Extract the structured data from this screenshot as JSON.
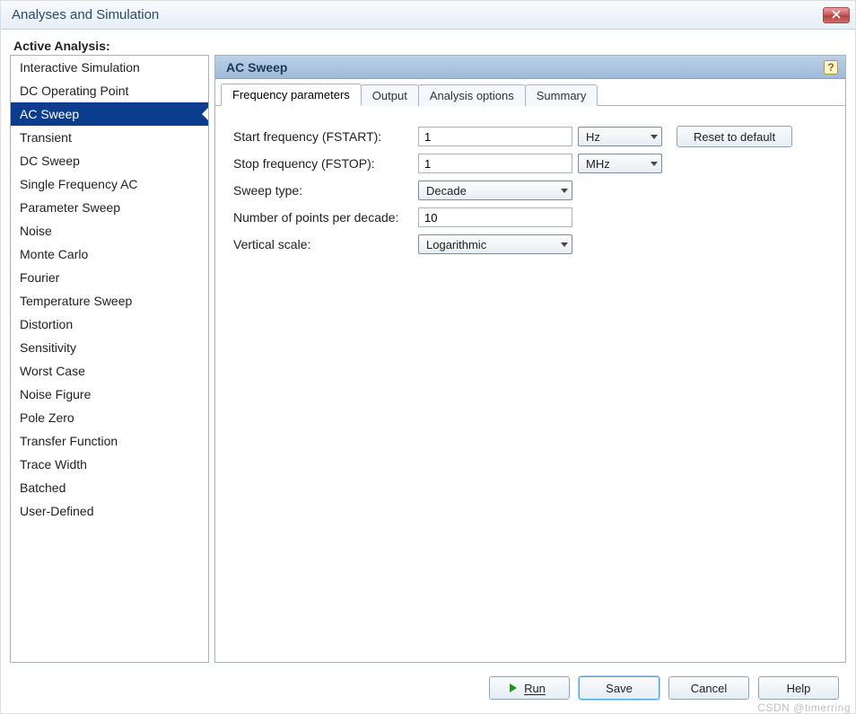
{
  "titlebar": {
    "title": "Analyses and Simulation"
  },
  "section_label": "Active Analysis:",
  "sidebar": {
    "items": [
      {
        "label": "Interactive Simulation"
      },
      {
        "label": "DC Operating Point"
      },
      {
        "label": "AC Sweep"
      },
      {
        "label": "Transient"
      },
      {
        "label": "DC Sweep"
      },
      {
        "label": "Single Frequency AC"
      },
      {
        "label": "Parameter Sweep"
      },
      {
        "label": "Noise"
      },
      {
        "label": "Monte Carlo"
      },
      {
        "label": "Fourier"
      },
      {
        "label": "Temperature Sweep"
      },
      {
        "label": "Distortion"
      },
      {
        "label": "Sensitivity"
      },
      {
        "label": "Worst Case"
      },
      {
        "label": "Noise Figure"
      },
      {
        "label": "Pole Zero"
      },
      {
        "label": "Transfer Function"
      },
      {
        "label": "Trace Width"
      },
      {
        "label": "Batched"
      },
      {
        "label": "User-Defined"
      }
    ],
    "selected_index": 2
  },
  "main": {
    "header": "AC Sweep",
    "help_icon_glyph": "?",
    "tabs": [
      {
        "label": "Frequency parameters"
      },
      {
        "label": "Output"
      },
      {
        "label": "Analysis options"
      },
      {
        "label": "Summary"
      }
    ],
    "active_tab_index": 0,
    "form": {
      "start_freq": {
        "label": "Start frequency (FSTART):",
        "value": "1",
        "unit": "Hz"
      },
      "stop_freq": {
        "label": "Stop frequency (FSTOP):",
        "value": "1",
        "unit": "MHz"
      },
      "sweep_type": {
        "label": "Sweep type:",
        "value": "Decade"
      },
      "points": {
        "label": "Number of points per decade:",
        "value": "10"
      },
      "vscale": {
        "label": "Vertical scale:",
        "value": "Logarithmic"
      },
      "reset_label": "Reset to default"
    }
  },
  "footer": {
    "run": "Run",
    "save": "Save",
    "cancel": "Cancel",
    "help": "Help"
  },
  "watermark": "CSDN @timerring"
}
